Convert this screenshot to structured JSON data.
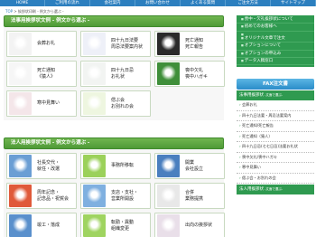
{
  "nav": [
    "HOME",
    "ご利用の流れ",
    "会社案内",
    "お問い合わせ",
    "よくある質問",
    "ご注文方法",
    "サイトマップ"
  ],
  "breadcrumb": {
    "home": "TOP",
    "sep": " > ",
    "current": "挨拶状印刷 - 例文から選ぶ -"
  },
  "sections": [
    {
      "title": "法事用挨拶状文例 - 例文から選ぶ -",
      "cards": [
        {
          "lines": [
            "会葬お礼"
          ],
          "icon": "chrysanthemum-photo",
          "color": "#f3f3f3"
        },
        {
          "lines": [
            "四十九日法要",
            "周忌法要案内状"
          ],
          "icon": "lily-photo",
          "color": "#eef0f8"
        },
        {
          "lines": [
            "死亡通知",
            "死亡報告"
          ],
          "icon": "white-lily-photo",
          "color": "#2a2a2a"
        },
        {
          "lines": [
            "死亡通知",
            "《猿人》"
          ],
          "icon": "white-flower-photo",
          "color": "#f6f6f6"
        },
        {
          "lines": [
            "四十九日忌",
            "お礼状"
          ],
          "icon": "lily-photo",
          "color": "#f2f4f2"
        },
        {
          "lines": [
            "喪中欠礼",
            "喪中ハガキ"
          ],
          "icon": "dew-leaf-photo",
          "color": "#3f8f3a"
        },
        {
          "lines": [
            "寒中見舞い"
          ],
          "icon": "flower-photo",
          "color": "#f4e6e9"
        },
        {
          "lines": [
            "偲ぶ会",
            "お別れの会"
          ],
          "icon": "green-leaf-photo",
          "color": "#eef6e0"
        }
      ]
    },
    {
      "title": "法人用挨拶状文例 - 例文から選ぶ -",
      "cards": [
        {
          "lines": [
            "社長交代・",
            "就任・改選"
          ],
          "icon": "building-photo",
          "color": "#6a9ed4"
        },
        {
          "lines": [
            "事務所移転"
          ],
          "icon": "green-leaf-photo",
          "color": "#9bd15a"
        },
        {
          "lines": [
            "開業",
            "会社設立"
          ],
          "icon": "skyscraper-photo",
          "color": "#4a7fbf"
        },
        {
          "lines": [
            "周年記念・",
            "記念品・祝賀会"
          ],
          "icon": "flower-photo",
          "color": "#e05a3a"
        },
        {
          "lines": [
            "支店・支社・",
            "営業所開設"
          ],
          "icon": "tower-photo",
          "color": "#7fb0e0"
        },
        {
          "lines": [
            "合併",
            "業務提携"
          ],
          "icon": "handshake-photo",
          "color": "#e8e8e8"
        },
        {
          "lines": [
            "竣工・落成"
          ],
          "icon": "building-photo",
          "color": "#5a90cc"
        },
        {
          "lines": [
            "転勤・異動",
            "組織変更"
          ],
          "icon": "green-leaf-photo",
          "color": "#9fd460"
        },
        {
          "lines": [
            "出向の挨拶状"
          ],
          "icon": "flower-photo",
          "color": "#e9dfe9"
        }
      ]
    }
  ],
  "sidebar": {
    "menu": [
      "喪中・欠礼挨拶状について",
      "初めてのお客様へ",
      "オリジナル文章で注文",
      "オプションについて",
      "オプションの申込み",
      "データ入稿窓口"
    ],
    "fax_title": "FAX注文書",
    "groups": [
      {
        "title": "法事用挨拶状",
        "sub": " -文面で選ぶ-",
        "links": [
          "会葬お礼",
          "四十九日法要・周忌法要案内",
          "死亡通知/死亡報告",
          "死亡通知（猿人）",
          "四十九日忌(七七日忌)法要お礼状",
          "喪中欠礼/喪中ハガキ",
          "寒中見舞い",
          "偲ぶ会・お別れの会"
        ]
      },
      {
        "title": "法人用挨拶状",
        "sub": " -文面で選ぶ-",
        "links": []
      }
    ]
  }
}
